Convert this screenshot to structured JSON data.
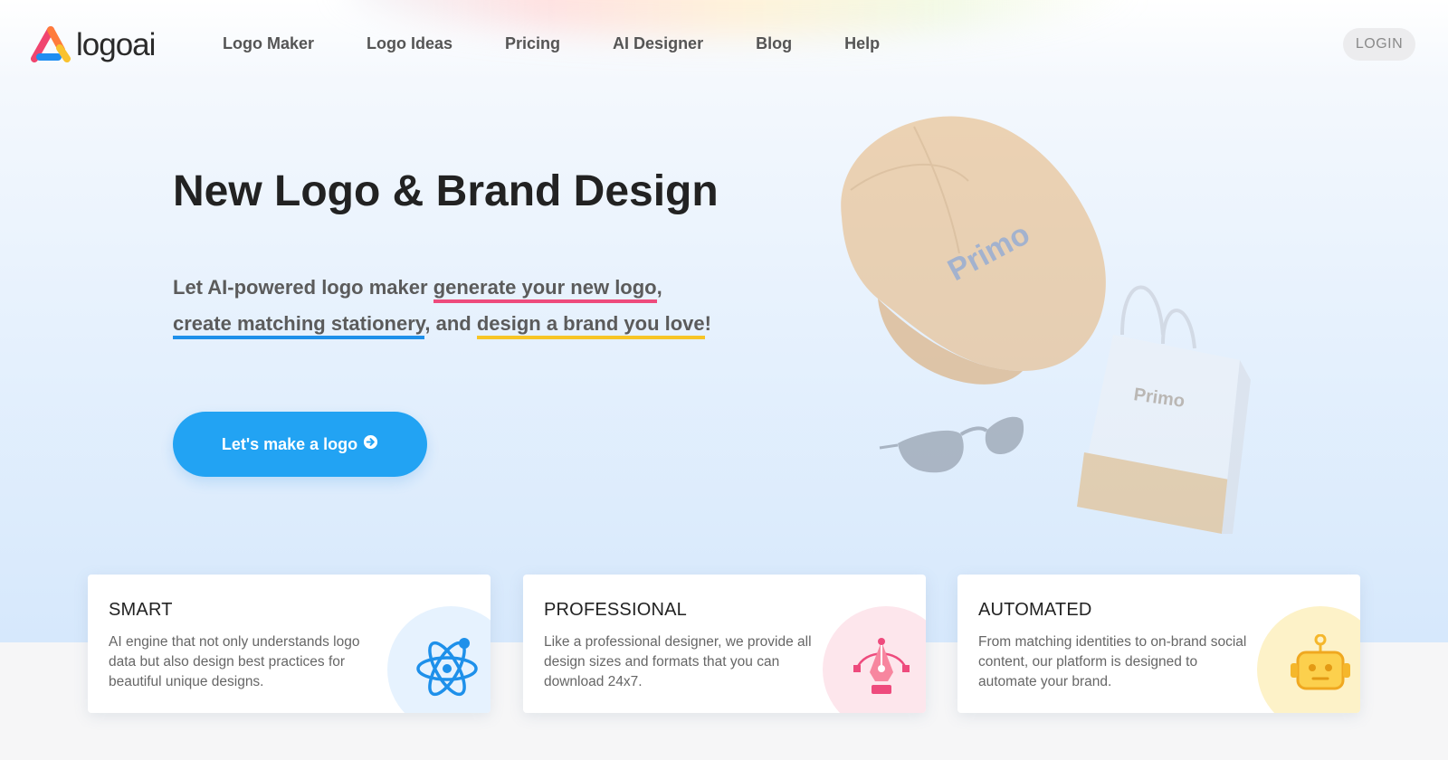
{
  "brand": {
    "name": "logoai"
  },
  "nav": {
    "items": [
      "Logo Maker",
      "Logo Ideas",
      "Pricing",
      "AI Designer",
      "Blog",
      "Help"
    ],
    "login_label": "LOGIN"
  },
  "hero": {
    "title": "New Logo & Brand Design",
    "subtitle": {
      "part1": "Let AI-powered logo maker ",
      "link1": "generate your new logo",
      "part2": ",",
      "link2": "create matching stationery",
      "part3": ", and ",
      "link3": "design a brand you love",
      "part4": "!"
    },
    "cta_label": "Let's make a logo"
  },
  "illustration": {
    "brand_text": "Primo"
  },
  "features": [
    {
      "title": "SMART",
      "text": "AI engine that not only understands logo data but also design best practices for beautiful unique designs.",
      "icon": "atom-icon"
    },
    {
      "title": "PROFESSIONAL",
      "text": "Like a professional designer, we provide all design sizes and formats that you can download 24x7.",
      "icon": "pen-tool-icon"
    },
    {
      "title": "AUTOMATED",
      "text": "From matching identities to on-brand social content, our platform is designed to automate your brand.",
      "icon": "robot-icon"
    }
  ],
  "colors": {
    "accent_blue": "#22a3f3",
    "underline_pink": "#ee4b7d",
    "underline_blue": "#1e90ea",
    "underline_yellow": "#f7c526"
  }
}
